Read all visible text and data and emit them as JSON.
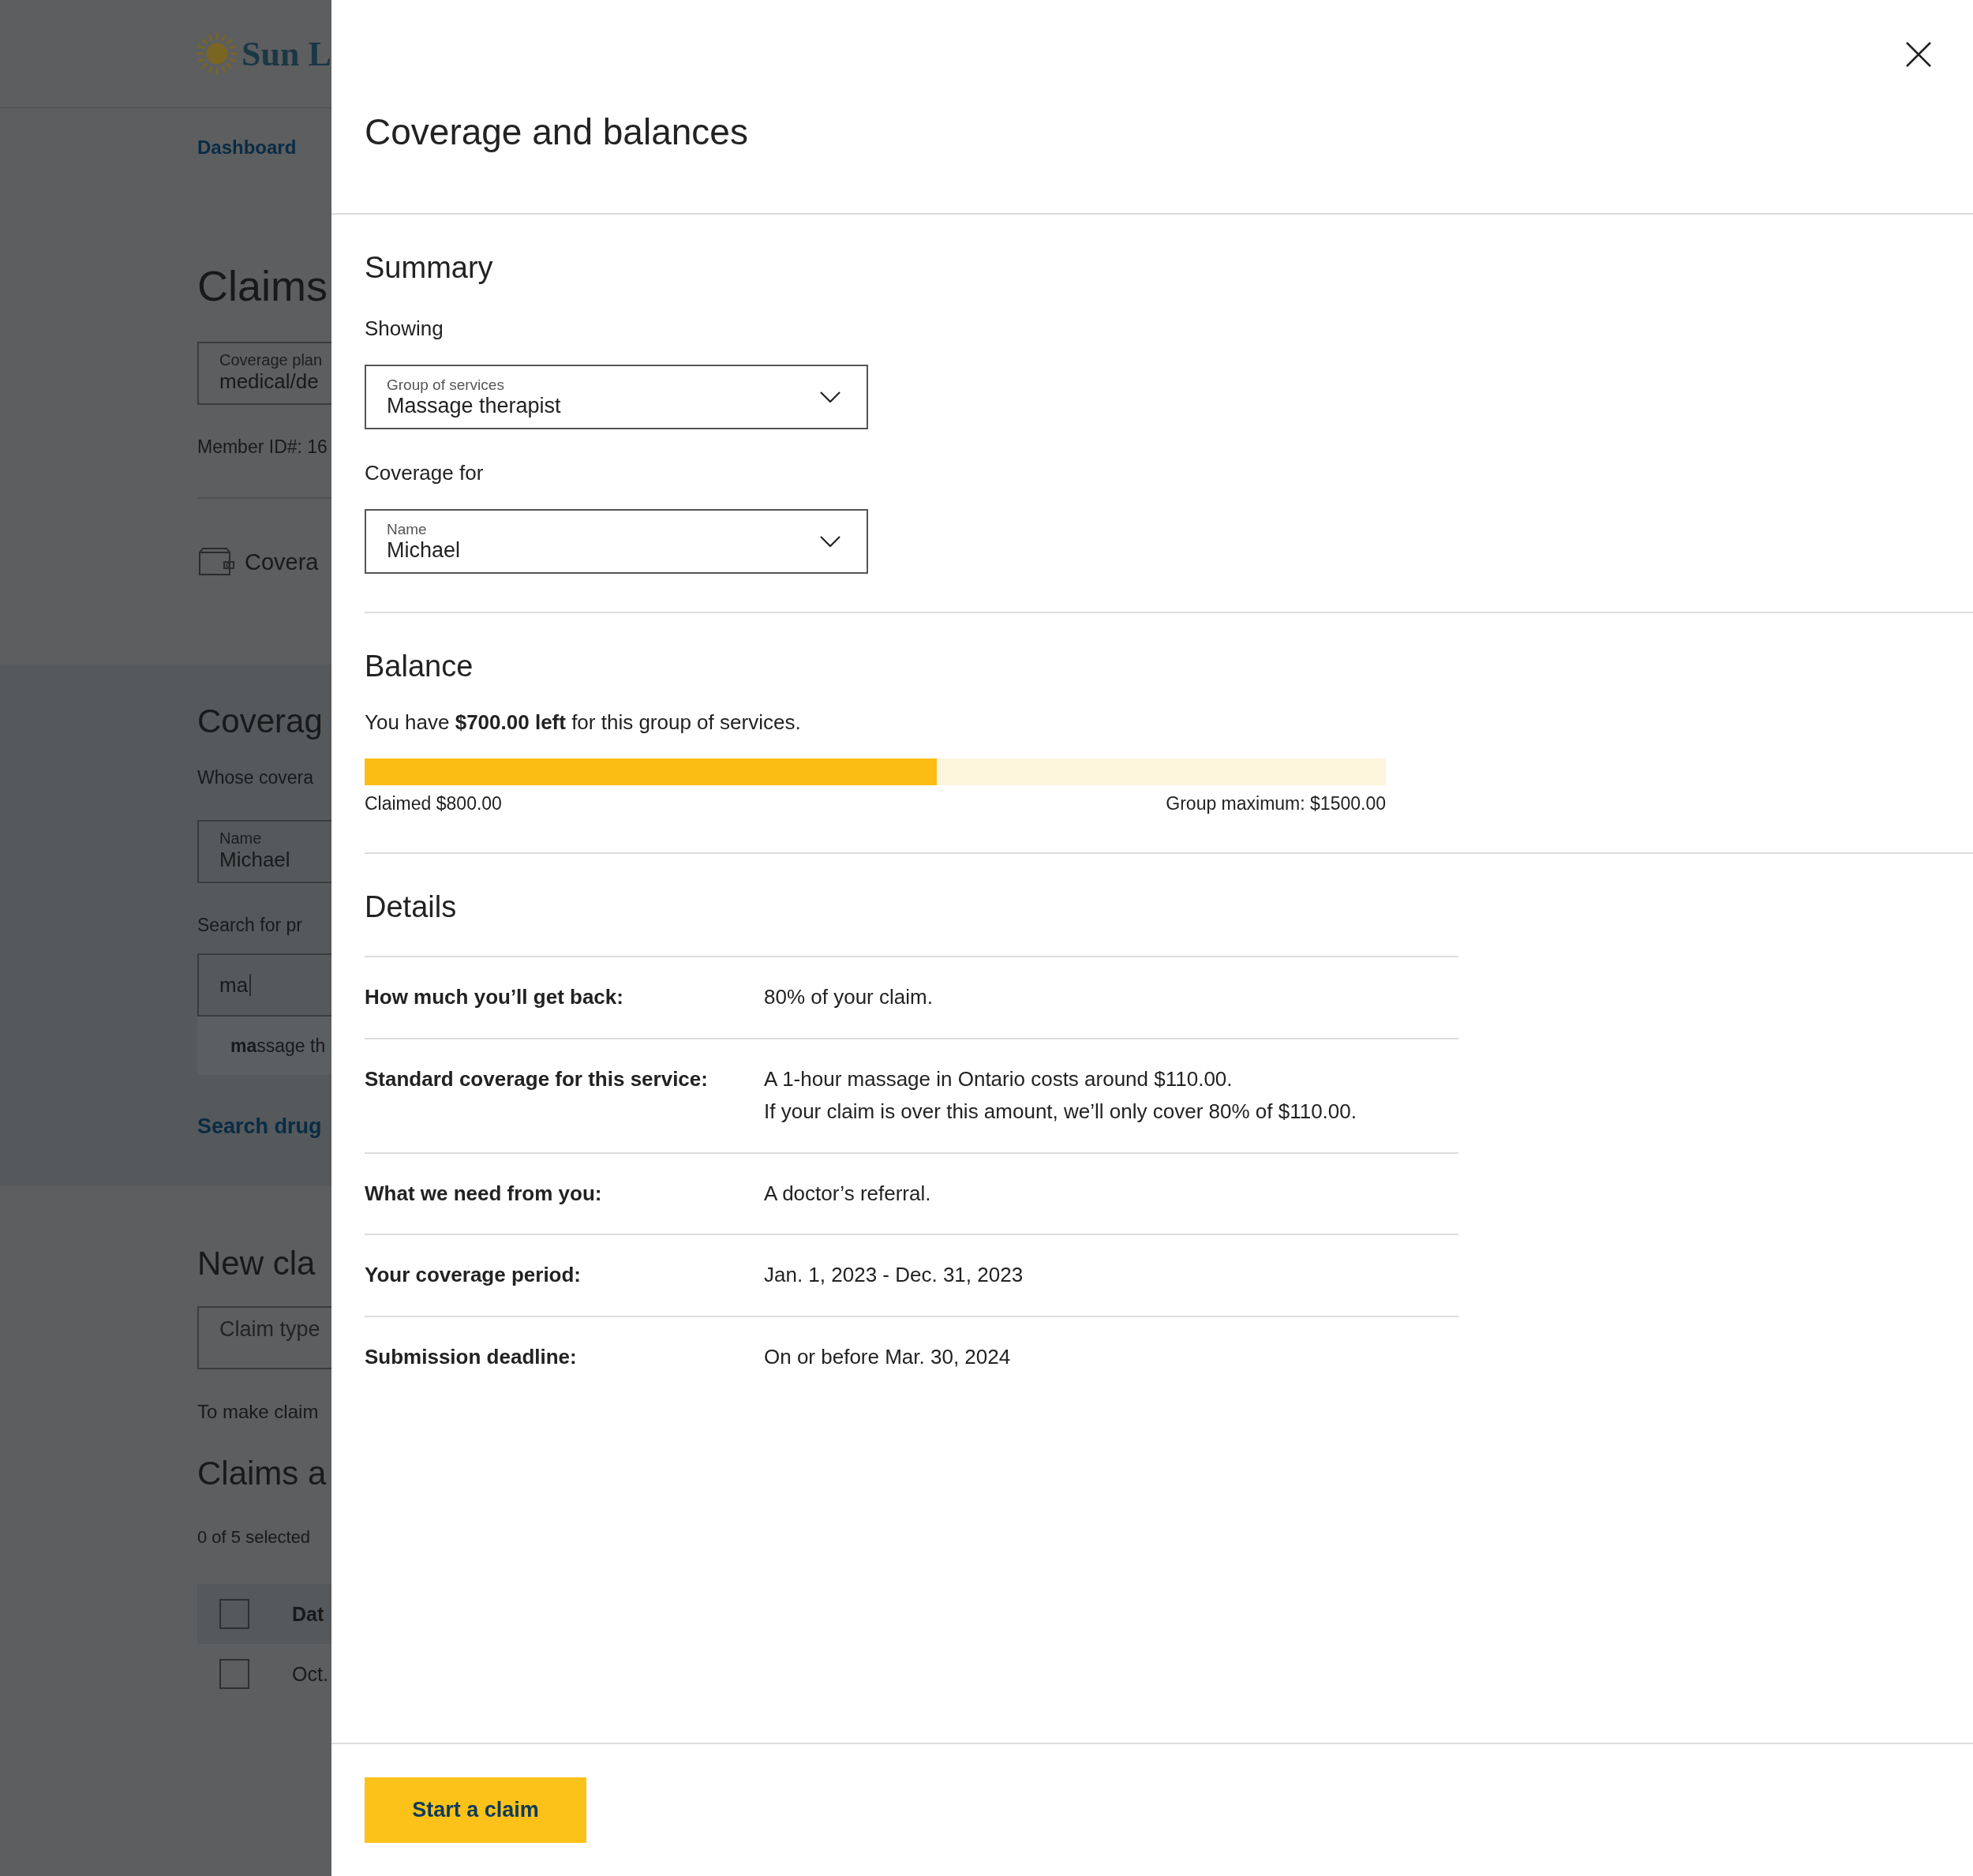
{
  "background_page": {
    "logo_text": "Sun L",
    "breadcrumb": "Dashboard",
    "heading": "Claims",
    "plan_field": {
      "label": "Coverage plan",
      "value": "medical/de"
    },
    "member_id": "Member ID#: 16",
    "coverage_link": "Covera",
    "coverage_section": {
      "heading": "Coverag",
      "whose_label": "Whose covera",
      "name_field": {
        "label": "Name",
        "value": "Michael"
      },
      "search_label": "Search for pr",
      "search_field": {
        "value": "ma"
      },
      "suggestion": "**ma**ssage th",
      "drug_link": "Search drug"
    },
    "new_claim": {
      "heading": "New cla",
      "claim_type_placeholder": "Claim type",
      "note": "To make claim"
    },
    "claims_list": {
      "heading": "Claims a",
      "selected_count": "0 of 5 selected",
      "header": {
        "label": "Dat",
        "checked": false
      },
      "rows": [
        {
          "label": "Oct.",
          "checked": false
        }
      ]
    }
  },
  "panel": {
    "title": "Coverage and balances",
    "summary": {
      "heading": "Summary",
      "fields": [
        {
          "label": "Showing",
          "field_label": "Group of services",
          "value": "Massage therapist"
        },
        {
          "label": "Coverage for",
          "field_label": "Name",
          "value": "Michael"
        }
      ]
    },
    "balance": {
      "heading": "Balance",
      "sentence": "You have **$700.00 left** for this group of services.",
      "level": 0.56,
      "claimed": "Claimed $800.00",
      "maximum": "Group maximum: $1500.00"
    },
    "details": {
      "heading": "Details",
      "rows": [
        {
          "label": "How much you’ll get back:",
          "lines": [
            "80% of your claim."
          ]
        },
        {
          "label": "Standard coverage for this service:",
          "lines": [
            "A 1-hour massage in Ontario costs around $110.00.",
            "If your claim is over this amount, we’ll only cover 80% of $110.00."
          ]
        },
        {
          "label": "What we need from you:",
          "lines": [
            "A doctor’s referral."
          ]
        },
        {
          "label": "Your coverage period:",
          "lines": [
            "Jan. 1, 2023 - Dec. 31, 2023"
          ]
        },
        {
          "label": "Submission deadline:",
          "lines": [
            "On or before Mar. 30, 2024"
          ]
        }
      ]
    },
    "button": "Start a claim"
  }
}
